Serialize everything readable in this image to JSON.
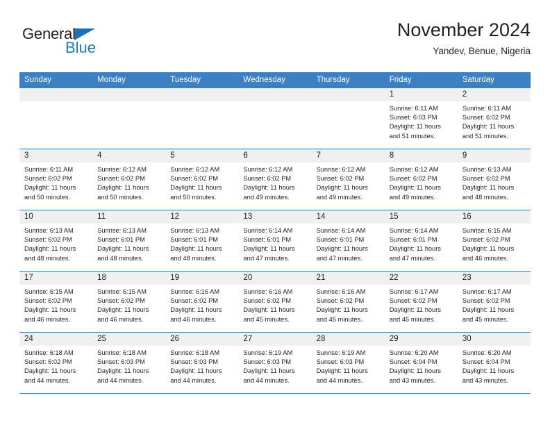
{
  "brand": {
    "name_part1": "General",
    "name_part2": "Blue",
    "triangle_color": "#1d6fb8",
    "blue_text_color": "#1f7ac4"
  },
  "header": {
    "title": "November 2024",
    "subtitle": "Yandev, Benue, Nigeria"
  },
  "theme": {
    "header_blue": "#3b7fc4",
    "day_head_gray": "#f0f0f0",
    "text_color": "#231f20"
  },
  "weekdays": [
    "Sunday",
    "Monday",
    "Tuesday",
    "Wednesday",
    "Thursday",
    "Friday",
    "Saturday"
  ],
  "weeks": [
    [
      {
        "day": "",
        "sunrise": "",
        "sunset": "",
        "daylight1": "",
        "daylight2": ""
      },
      {
        "day": "",
        "sunrise": "",
        "sunset": "",
        "daylight1": "",
        "daylight2": ""
      },
      {
        "day": "",
        "sunrise": "",
        "sunset": "",
        "daylight1": "",
        "daylight2": ""
      },
      {
        "day": "",
        "sunrise": "",
        "sunset": "",
        "daylight1": "",
        "daylight2": ""
      },
      {
        "day": "",
        "sunrise": "",
        "sunset": "",
        "daylight1": "",
        "daylight2": ""
      },
      {
        "day": "1",
        "sunrise": "Sunrise: 6:11 AM",
        "sunset": "Sunset: 6:03 PM",
        "daylight1": "Daylight: 11 hours",
        "daylight2": "and 51 minutes."
      },
      {
        "day": "2",
        "sunrise": "Sunrise: 6:11 AM",
        "sunset": "Sunset: 6:02 PM",
        "daylight1": "Daylight: 11 hours",
        "daylight2": "and 51 minutes."
      }
    ],
    [
      {
        "day": "3",
        "sunrise": "Sunrise: 6:11 AM",
        "sunset": "Sunset: 6:02 PM",
        "daylight1": "Daylight: 11 hours",
        "daylight2": "and 50 minutes."
      },
      {
        "day": "4",
        "sunrise": "Sunrise: 6:12 AM",
        "sunset": "Sunset: 6:02 PM",
        "daylight1": "Daylight: 11 hours",
        "daylight2": "and 50 minutes."
      },
      {
        "day": "5",
        "sunrise": "Sunrise: 6:12 AM",
        "sunset": "Sunset: 6:02 PM",
        "daylight1": "Daylight: 11 hours",
        "daylight2": "and 50 minutes."
      },
      {
        "day": "6",
        "sunrise": "Sunrise: 6:12 AM",
        "sunset": "Sunset: 6:02 PM",
        "daylight1": "Daylight: 11 hours",
        "daylight2": "and 49 minutes."
      },
      {
        "day": "7",
        "sunrise": "Sunrise: 6:12 AM",
        "sunset": "Sunset: 6:02 PM",
        "daylight1": "Daylight: 11 hours",
        "daylight2": "and 49 minutes."
      },
      {
        "day": "8",
        "sunrise": "Sunrise: 6:12 AM",
        "sunset": "Sunset: 6:02 PM",
        "daylight1": "Daylight: 11 hours",
        "daylight2": "and 49 minutes."
      },
      {
        "day": "9",
        "sunrise": "Sunrise: 6:13 AM",
        "sunset": "Sunset: 6:02 PM",
        "daylight1": "Daylight: 11 hours",
        "daylight2": "and 48 minutes."
      }
    ],
    [
      {
        "day": "10",
        "sunrise": "Sunrise: 6:13 AM",
        "sunset": "Sunset: 6:02 PM",
        "daylight1": "Daylight: 11 hours",
        "daylight2": "and 48 minutes."
      },
      {
        "day": "11",
        "sunrise": "Sunrise: 6:13 AM",
        "sunset": "Sunset: 6:01 PM",
        "daylight1": "Daylight: 11 hours",
        "daylight2": "and 48 minutes."
      },
      {
        "day": "12",
        "sunrise": "Sunrise: 6:13 AM",
        "sunset": "Sunset: 6:01 PM",
        "daylight1": "Daylight: 11 hours",
        "daylight2": "and 48 minutes."
      },
      {
        "day": "13",
        "sunrise": "Sunrise: 6:14 AM",
        "sunset": "Sunset: 6:01 PM",
        "daylight1": "Daylight: 11 hours",
        "daylight2": "and 47 minutes."
      },
      {
        "day": "14",
        "sunrise": "Sunrise: 6:14 AM",
        "sunset": "Sunset: 6:01 PM",
        "daylight1": "Daylight: 11 hours",
        "daylight2": "and 47 minutes."
      },
      {
        "day": "15",
        "sunrise": "Sunrise: 6:14 AM",
        "sunset": "Sunset: 6:01 PM",
        "daylight1": "Daylight: 11 hours",
        "daylight2": "and 47 minutes."
      },
      {
        "day": "16",
        "sunrise": "Sunrise: 6:15 AM",
        "sunset": "Sunset: 6:02 PM",
        "daylight1": "Daylight: 11 hours",
        "daylight2": "and 46 minutes."
      }
    ],
    [
      {
        "day": "17",
        "sunrise": "Sunrise: 6:15 AM",
        "sunset": "Sunset: 6:02 PM",
        "daylight1": "Daylight: 11 hours",
        "daylight2": "and 46 minutes."
      },
      {
        "day": "18",
        "sunrise": "Sunrise: 6:15 AM",
        "sunset": "Sunset: 6:02 PM",
        "daylight1": "Daylight: 11 hours",
        "daylight2": "and 46 minutes."
      },
      {
        "day": "19",
        "sunrise": "Sunrise: 6:16 AM",
        "sunset": "Sunset: 6:02 PM",
        "daylight1": "Daylight: 11 hours",
        "daylight2": "and 46 minutes."
      },
      {
        "day": "20",
        "sunrise": "Sunrise: 6:16 AM",
        "sunset": "Sunset: 6:02 PM",
        "daylight1": "Daylight: 11 hours",
        "daylight2": "and 45 minutes."
      },
      {
        "day": "21",
        "sunrise": "Sunrise: 6:16 AM",
        "sunset": "Sunset: 6:02 PM",
        "daylight1": "Daylight: 11 hours",
        "daylight2": "and 45 minutes."
      },
      {
        "day": "22",
        "sunrise": "Sunrise: 6:17 AM",
        "sunset": "Sunset: 6:02 PM",
        "daylight1": "Daylight: 11 hours",
        "daylight2": "and 45 minutes."
      },
      {
        "day": "23",
        "sunrise": "Sunrise: 6:17 AM",
        "sunset": "Sunset: 6:02 PM",
        "daylight1": "Daylight: 11 hours",
        "daylight2": "and 45 minutes."
      }
    ],
    [
      {
        "day": "24",
        "sunrise": "Sunrise: 6:18 AM",
        "sunset": "Sunset: 6:02 PM",
        "daylight1": "Daylight: 11 hours",
        "daylight2": "and 44 minutes."
      },
      {
        "day": "25",
        "sunrise": "Sunrise: 6:18 AM",
        "sunset": "Sunset: 6:03 PM",
        "daylight1": "Daylight: 11 hours",
        "daylight2": "and 44 minutes."
      },
      {
        "day": "26",
        "sunrise": "Sunrise: 6:18 AM",
        "sunset": "Sunset: 6:03 PM",
        "daylight1": "Daylight: 11 hours",
        "daylight2": "and 44 minutes."
      },
      {
        "day": "27",
        "sunrise": "Sunrise: 6:19 AM",
        "sunset": "Sunset: 6:03 PM",
        "daylight1": "Daylight: 11 hours",
        "daylight2": "and 44 minutes."
      },
      {
        "day": "28",
        "sunrise": "Sunrise: 6:19 AM",
        "sunset": "Sunset: 6:03 PM",
        "daylight1": "Daylight: 11 hours",
        "daylight2": "and 44 minutes."
      },
      {
        "day": "29",
        "sunrise": "Sunrise: 6:20 AM",
        "sunset": "Sunset: 6:04 PM",
        "daylight1": "Daylight: 11 hours",
        "daylight2": "and 43 minutes."
      },
      {
        "day": "30",
        "sunrise": "Sunrise: 6:20 AM",
        "sunset": "Sunset: 6:04 PM",
        "daylight1": "Daylight: 11 hours",
        "daylight2": "and 43 minutes."
      }
    ]
  ]
}
